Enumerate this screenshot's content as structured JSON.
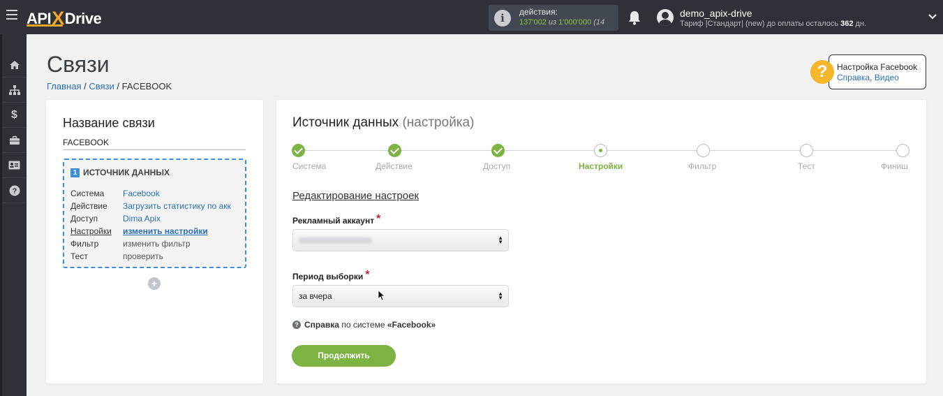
{
  "header": {
    "logo_left": "API",
    "logo_x": "X",
    "logo_right": "Drive",
    "actions_label": "действия:",
    "actions_used": "137'002",
    "actions_of": "из",
    "actions_total": "1'000'000",
    "actions_extra": "(14",
    "user_name": "demo_apix-drive",
    "plan_text": "Тариф |Стандарт| (new) до оплаты осталось",
    "plan_days": "362",
    "plan_days_unit": "дн."
  },
  "sidebar": {
    "items": [
      {
        "icon": "home-icon"
      },
      {
        "icon": "sitemap-icon"
      },
      {
        "icon": "dollar-icon"
      },
      {
        "icon": "briefcase-icon"
      },
      {
        "icon": "id-card-icon"
      },
      {
        "icon": "question-icon"
      }
    ]
  },
  "page": {
    "title": "Связи",
    "breadcrumb": {
      "home": "Главная",
      "sep1": "/",
      "links": "Связи",
      "sep2": "/",
      "current": "FACEBOOK"
    }
  },
  "help": {
    "title": "Настройка Facebook",
    "link1": "Справка",
    "comma": ",",
    "link2": "Видео"
  },
  "left": {
    "title": "Название связи",
    "name_value": "FACEBOOK",
    "source_num": "1",
    "source_title": "ИСТОЧНИК ДАННЫХ",
    "rows": [
      {
        "key": "Система",
        "value": "Facebook"
      },
      {
        "key": "Действие",
        "value": "Загрузить статистику по акк"
      },
      {
        "key": "Доступ",
        "value": "Dima Apix"
      },
      {
        "key": "Настройки",
        "value": "изменить настройки"
      },
      {
        "key": "Фильтр",
        "value": "изменить фильтр"
      },
      {
        "key": "Тест",
        "value": "проверить"
      }
    ],
    "add_label": "+"
  },
  "right": {
    "title": "Источник данных",
    "title_sub": "(настройка)",
    "steps": [
      {
        "label": "Система",
        "state": "done"
      },
      {
        "label": "Действие",
        "state": "done"
      },
      {
        "label": "Доступ",
        "state": "done"
      },
      {
        "label": "Настройки",
        "state": "current"
      },
      {
        "label": "Фильтр",
        "state": "todo"
      },
      {
        "label": "Тест",
        "state": "todo"
      },
      {
        "label": "Финиш",
        "state": "todo"
      }
    ],
    "edit_title": "Редактирование настроек",
    "field1_label": "Рекламный аккаунт",
    "field2_label": "Период выборки",
    "required_mark": "*",
    "field2_value": "за вчера",
    "help_word": "Справка",
    "help_text": "по системе",
    "help_system": "«Facebook»",
    "continue_label": "Продолжить"
  },
  "colors": {
    "accent_green": "#7cb342",
    "link_blue": "#2a6fb6",
    "topbar": "#2e3238",
    "logo_orange": "#f5a623"
  }
}
